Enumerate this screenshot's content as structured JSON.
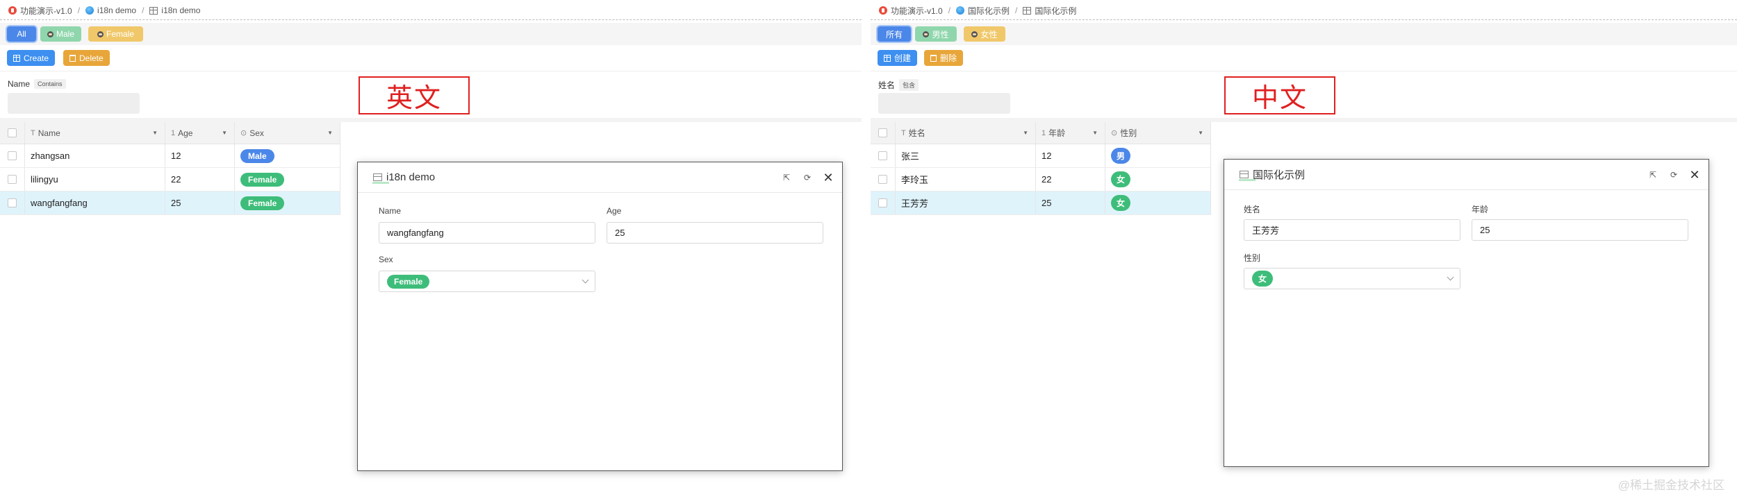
{
  "left": {
    "breadcrumb": {
      "app": "功能演示-v1.0",
      "section": "i18n demo",
      "page": "i18n demo"
    },
    "tabs": {
      "all": "All",
      "male": "Male",
      "female": "Female"
    },
    "actions": {
      "create": "Create",
      "delete": "Delete"
    },
    "filter": {
      "label": "Name",
      "operator": "Contains"
    },
    "annotation": "英文",
    "grid": {
      "headers": {
        "name": "Name",
        "age": "Age",
        "sex": "Sex"
      },
      "rows": [
        {
          "name": "zhangsan",
          "age": "12",
          "sex": "Male"
        },
        {
          "name": "lilingyu",
          "age": "22",
          "sex": "Female"
        },
        {
          "name": "wangfangfang",
          "age": "25",
          "sex": "Female"
        }
      ]
    },
    "modal": {
      "title": "i18n demo",
      "name_label": "Name",
      "name_value": "wangfangfang",
      "age_label": "Age",
      "age_value": "25",
      "sex_label": "Sex",
      "sex_value": "Female"
    }
  },
  "right": {
    "breadcrumb": {
      "app": "功能演示-v1.0",
      "section": "国际化示例",
      "page": "国际化示例"
    },
    "tabs": {
      "all": "所有",
      "male": "男性",
      "female": "女性"
    },
    "actions": {
      "create": "创建",
      "delete": "删除"
    },
    "filter": {
      "label": "姓名",
      "operator": "包含"
    },
    "annotation": "中文",
    "grid": {
      "headers": {
        "name": "姓名",
        "age": "年龄",
        "sex": "性别"
      },
      "rows": [
        {
          "name": "张三",
          "age": "12",
          "sex": "男"
        },
        {
          "name": "李玲玉",
          "age": "22",
          "sex": "女"
        },
        {
          "name": "王芳芳",
          "age": "25",
          "sex": "女"
        }
      ]
    },
    "modal": {
      "title": "国际化示例",
      "name_label": "姓名",
      "name_value": "王芳芳",
      "age_label": "年龄",
      "age_value": "25",
      "sex_label": "性别",
      "sex_value": "女"
    }
  },
  "watermark": "@稀土掘金技术社区",
  "colors": {
    "primary": "#4b87e8",
    "create": "#3d8ff0",
    "delete": "#e8a63a",
    "male": "#4b87e8",
    "female": "#3ebd7a",
    "annotation": "#e02020"
  },
  "icons": [
    "app-logo-icon",
    "globe-icon",
    "table-icon",
    "person-icon",
    "grid-icon",
    "trash-icon",
    "checkbox-icon",
    "sort-caret-icon",
    "external-link-icon",
    "refresh-icon",
    "close-icon",
    "chevron-down-icon"
  ]
}
